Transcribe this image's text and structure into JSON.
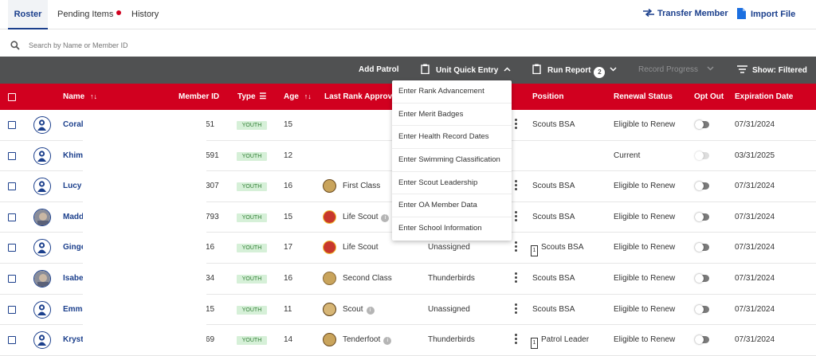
{
  "tabs": [
    {
      "label": "Roster",
      "active": true
    },
    {
      "label": "Pending Items",
      "dot_color": "#d1001f"
    },
    {
      "label": "History"
    }
  ],
  "top_actions": {
    "transfer": "Transfer Member",
    "import": "Import File"
  },
  "search": {
    "placeholder": "Search by Name or Member ID"
  },
  "toolbar": {
    "add_patrol": "Add Patrol",
    "unit_quick_entry": "Unit Quick Entry",
    "run_report": "Run Report",
    "run_report_count": "2",
    "record_progress": "Record Progress",
    "show_filtered": "Show: Filtered"
  },
  "columns": {
    "name": "Name",
    "member_id": "Member ID",
    "type": "Type",
    "age": "Age",
    "last_rank": "Last Rank Approved",
    "position": "Position",
    "renewal": "Renewal Status",
    "opt_out": "Opt Out",
    "expiration": "Expiration Date"
  },
  "rows": [
    {
      "name": "Coral",
      "id": "51",
      "type": "YOUTH",
      "age": "15",
      "rank": "",
      "patrol": "",
      "position": "Scouts BSA",
      "renewal": "Eligible to Renew",
      "expiration": "07/31/2024",
      "toggle": "on"
    },
    {
      "name": "Khima",
      "id": "591",
      "type": "YOUTH",
      "age": "12",
      "rank": "",
      "patrol": "",
      "position": "",
      "renewal": "Current",
      "expiration": "03/31/2025",
      "toggle": "off"
    },
    {
      "name": "Lucy F",
      "id": "307",
      "type": "YOUTH",
      "age": "16",
      "rank": "First Class",
      "patrol": "",
      "position": "Scouts BSA",
      "renewal": "Eligible to Renew",
      "expiration": "07/31/2024",
      "toggle": "on"
    },
    {
      "name": "Maddi",
      "id": "793",
      "type": "YOUTH",
      "age": "15",
      "rank": "Life Scout",
      "patrol": "",
      "position": "Scouts BSA",
      "renewal": "Eligible to Renew",
      "expiration": "07/31/2024",
      "toggle": "on"
    },
    {
      "name": "Ginge",
      "id": "16",
      "type": "YOUTH",
      "age": "17",
      "rank": "Life Scout",
      "patrol": "Unassigned",
      "position": "Scouts BSA",
      "position_box": "1",
      "renewal": "Eligible to Renew",
      "expiration": "07/31/2024",
      "toggle": "on"
    },
    {
      "name": "Isabel",
      "id": "34",
      "type": "YOUTH",
      "age": "16",
      "rank": "Second Class",
      "patrol": "Thunderbirds",
      "position": "Scouts BSA",
      "renewal": "Eligible to Renew",
      "expiration": "07/31/2024",
      "toggle": "on"
    },
    {
      "name": "Emma",
      "id": "15",
      "type": "YOUTH",
      "age": "11",
      "rank": "Scout",
      "patrol": "Unassigned",
      "position": "Scouts BSA",
      "renewal": "Eligible to Renew",
      "expiration": "07/31/2024",
      "toggle": "on"
    },
    {
      "name": "Krysta",
      "id": "69",
      "type": "YOUTH",
      "age": "14",
      "rank": "Tenderfoot",
      "patrol": "Thunderbirds",
      "position": "Patrol Leader",
      "position_box": "1",
      "renewal": "Eligible to Renew",
      "expiration": "07/31/2024",
      "toggle": "on"
    }
  ],
  "quick_entry_menu": [
    "Enter Rank Advancement",
    "Enter Merit Badges",
    "Enter Health Record Dates",
    "Enter Swimming Classification",
    "Enter Scout Leadership",
    "Enter OA Member Data",
    "Enter School Information"
  ],
  "colors": {
    "brand_red": "#d1001f",
    "brand_blue": "#1b3f8c",
    "toolbar_gray": "#505152"
  }
}
